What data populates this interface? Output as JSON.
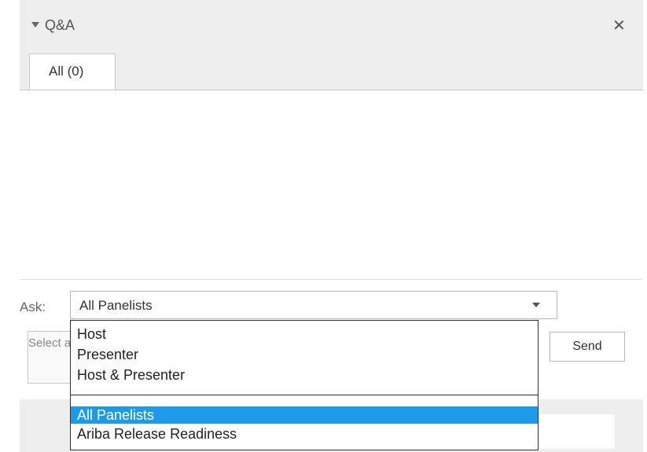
{
  "panel": {
    "title": "Q&A",
    "close_glyph": "✕",
    "collapse_icon": "triangle-down-icon"
  },
  "tabs": [
    {
      "label": "All (0)",
      "active": true
    }
  ],
  "ask": {
    "label": "Ask:",
    "selected": "All Panelists"
  },
  "question_input": {
    "placeholder": "Select a recipient and type your question"
  },
  "send_label": "Send",
  "dropdown": {
    "options": [
      {
        "label": "Host"
      },
      {
        "label": "Presenter"
      },
      {
        "label": "Host & Presenter"
      },
      {
        "label": "All Panelists",
        "selected": true
      },
      {
        "label": "Ariba Release Readiness"
      }
    ]
  },
  "colors": {
    "selected_highlight": "#1e9be8",
    "header_bg": "#eeeeee"
  }
}
